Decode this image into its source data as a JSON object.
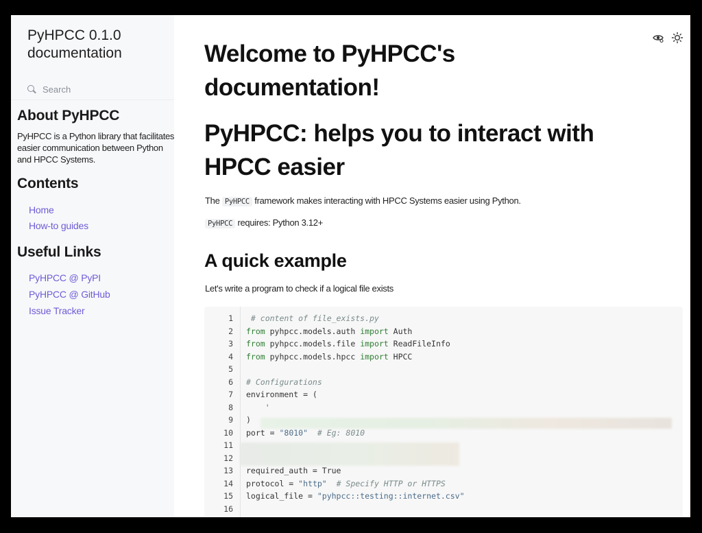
{
  "sidebar": {
    "brand": "PyHPCC 0.1.0 documentation",
    "search_placeholder": "Search",
    "about": {
      "title": "About PyHPCC",
      "text": "PyHPCC is a Python library that facilitates easier communication between Python and HPCC Systems."
    },
    "contents": {
      "title": "Contents",
      "items": [
        "Home",
        "How-to guides"
      ]
    },
    "links": {
      "title": "Useful Links",
      "items": [
        "PyHPCC @ PyPI",
        "PyHPCC @ GitHub",
        "Issue Tracker"
      ]
    }
  },
  "header_icons": [
    "eye-icon",
    "sun-icon"
  ],
  "main": {
    "title": "Welcome to PyHPCC's documentation!",
    "subtitle": "PyHPCC: helps you to interact with HPCC easier",
    "intro": {
      "before": "The ",
      "code": "PyHPCC",
      "after": " framework makes interacting with HPCC Systems easier using Python."
    },
    "requires": {
      "code": "PyHPCC",
      "after": " requires: Python 3.12+"
    },
    "example_title": "A quick example",
    "example_desc": "Let's write a program to check if a logical file exists",
    "code_lines": [
      {
        "n": "1",
        "parts": [
          {
            "t": " # content of file_exists.py",
            "c": "c"
          }
        ]
      },
      {
        "n": "2",
        "parts": [
          {
            "t": "from",
            "c": "k"
          },
          {
            "t": " pyhpcc.models.auth ",
            "c": ""
          },
          {
            "t": "import",
            "c": "k"
          },
          {
            "t": " Auth",
            "c": ""
          }
        ]
      },
      {
        "n": "3",
        "parts": [
          {
            "t": "from",
            "c": "k"
          },
          {
            "t": " pyhpcc.models.file ",
            "c": ""
          },
          {
            "t": "import",
            "c": "k"
          },
          {
            "t": " ReadFileInfo",
            "c": ""
          }
        ]
      },
      {
        "n": "4",
        "parts": [
          {
            "t": "from",
            "c": "k"
          },
          {
            "t": " pyhpcc.models.hpcc ",
            "c": ""
          },
          {
            "t": "import",
            "c": "k"
          },
          {
            "t": " HPCC",
            "c": ""
          }
        ]
      },
      {
        "n": "5",
        "parts": []
      },
      {
        "n": "6",
        "parts": [
          {
            "t": "# Configurations",
            "c": "c"
          }
        ]
      },
      {
        "n": "7",
        "parts": [
          {
            "t": "environment = (",
            "c": ""
          }
        ]
      },
      {
        "n": "8",
        "parts": [
          {
            "t": "    '",
            "c": "s"
          }
        ]
      },
      {
        "n": "9",
        "parts": [
          {
            "t": ")",
            "c": ""
          }
        ]
      },
      {
        "n": "10",
        "parts": [
          {
            "t": "port = ",
            "c": ""
          },
          {
            "t": "\"8010\"",
            "c": "s"
          },
          {
            "t": "  # Eg: 8010",
            "c": "c"
          }
        ]
      },
      {
        "n": "11",
        "parts": []
      },
      {
        "n": "12",
        "parts": []
      },
      {
        "n": "13",
        "parts": [
          {
            "t": "required_auth = True",
            "c": ""
          }
        ]
      },
      {
        "n": "14",
        "parts": [
          {
            "t": "protocol = ",
            "c": ""
          },
          {
            "t": "\"http\"",
            "c": "s"
          },
          {
            "t": "  # Specify HTTP or HTTPS",
            "c": "c"
          }
        ]
      },
      {
        "n": "15",
        "parts": [
          {
            "t": "logical_file = ",
            "c": ""
          },
          {
            "t": "\"pyhpcc::testing::internet.csv\"",
            "c": "s"
          }
        ]
      },
      {
        "n": "16",
        "parts": []
      }
    ]
  }
}
